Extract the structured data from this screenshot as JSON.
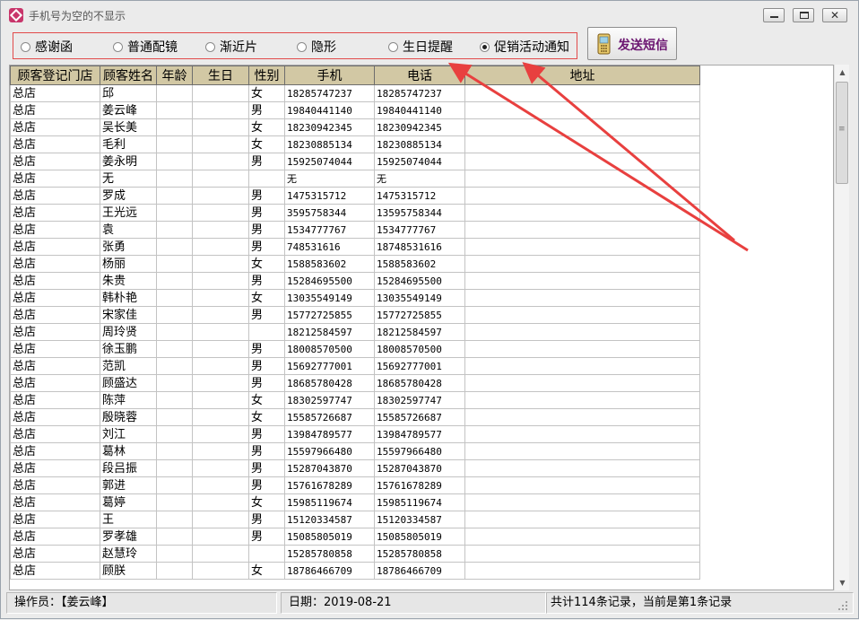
{
  "window": {
    "title": "手机号为空的不显示"
  },
  "message_types": [
    {
      "label": "感谢函",
      "checked": false
    },
    {
      "label": "普通配镜",
      "checked": false
    },
    {
      "label": "渐近片",
      "checked": false
    },
    {
      "label": "隐形",
      "checked": false
    },
    {
      "label": "生日提醒",
      "checked": false
    },
    {
      "label": "促销活动通知",
      "checked": true
    }
  ],
  "send_button": {
    "label": "发送短信",
    "icon": "mobile-phone-icon"
  },
  "table": {
    "columns": [
      "顾客登记门店",
      "顾客姓名",
      "年龄",
      "生日",
      "性别",
      "手机",
      "电话",
      "地址"
    ],
    "rows": [
      [
        "总店",
        "邱",
        "",
        "",
        "女",
        "18285747237",
        "18285747237",
        ""
      ],
      [
        "总店",
        "姜云峰",
        "",
        "",
        "男",
        "19840441140",
        "19840441140",
        ""
      ],
      [
        "总店",
        "吴长美",
        "",
        "",
        "女",
        "18230942345",
        "18230942345",
        ""
      ],
      [
        "总店",
        "毛利",
        "",
        "",
        "女",
        "18230885134",
        "18230885134",
        ""
      ],
      [
        "总店",
        "姜永明",
        "",
        "",
        "男",
        "15925074044",
        "15925074044",
        ""
      ],
      [
        "总店",
        "无",
        "",
        "",
        "",
        "无",
        "无",
        ""
      ],
      [
        "总店",
        "罗成",
        "",
        "",
        "男",
        "1475315712",
        "1475315712",
        ""
      ],
      [
        "总店",
        "王光远",
        "",
        "",
        "男",
        "3595758344",
        "13595758344",
        ""
      ],
      [
        "总店",
        "袁",
        "",
        "",
        "男",
        "1534777767",
        "1534777767",
        ""
      ],
      [
        "总店",
        "张勇",
        "",
        "",
        "男",
        "748531616",
        "18748531616",
        ""
      ],
      [
        "总店",
        "杨丽",
        "",
        "",
        "女",
        "1588583602",
        "1588583602",
        ""
      ],
      [
        "总店",
        "朱贵",
        "",
        "",
        "男",
        "15284695500",
        "15284695500",
        ""
      ],
      [
        "总店",
        "韩朴艳",
        "",
        "",
        "女",
        "13035549149",
        "13035549149",
        ""
      ],
      [
        "总店",
        "宋家佳",
        "",
        "",
        "男",
        "15772725855",
        "15772725855",
        ""
      ],
      [
        "总店",
        "周玲贤",
        "",
        "",
        "",
        "18212584597",
        "18212584597",
        ""
      ],
      [
        "总店",
        "徐玉鹏",
        "",
        "",
        "男",
        "18008570500",
        "18008570500",
        ""
      ],
      [
        "总店",
        "范凯",
        "",
        "",
        "男",
        "15692777001",
        "15692777001",
        ""
      ],
      [
        "总店",
        "顾盛达",
        "",
        "",
        "男",
        "18685780428",
        "18685780428",
        ""
      ],
      [
        "总店",
        "陈萍",
        "",
        "",
        "女",
        "18302597747",
        "18302597747",
        ""
      ],
      [
        "总店",
        "殷晓蓉",
        "",
        "",
        "女",
        "15585726687",
        "15585726687",
        ""
      ],
      [
        "总店",
        "刘江",
        "",
        "",
        "男",
        "13984789577",
        "13984789577",
        ""
      ],
      [
        "总店",
        "葛林",
        "",
        "",
        "男",
        "15597966480",
        "15597966480",
        ""
      ],
      [
        "总店",
        "段吕振",
        "",
        "",
        "男",
        "15287043870",
        "15287043870",
        ""
      ],
      [
        "总店",
        "郭进",
        "",
        "",
        "男",
        "15761678289",
        "15761678289",
        ""
      ],
      [
        "总店",
        "葛婷",
        "",
        "",
        "女",
        "15985119674",
        "15985119674",
        ""
      ],
      [
        "总店",
        "王",
        "",
        "",
        "男",
        "15120334587",
        "15120334587",
        ""
      ],
      [
        "总店",
        "罗孝雄",
        "",
        "",
        "男",
        "15085805019",
        "15085805019",
        ""
      ],
      [
        "总店",
        "赵慧玲",
        "",
        "",
        "",
        "15285780858",
        "15285780858",
        ""
      ],
      [
        "总店",
        "顾朕",
        "",
        "",
        "女",
        "18786466709",
        "18786466709",
        ""
      ]
    ]
  },
  "status": {
    "operator": "操作员：【姜云峰】",
    "date": "日期：2019-08-21",
    "records": "共计114条记录，当前是第1条记录"
  },
  "colors": {
    "header_bg": "#d2c8a4",
    "highlight_border": "#e24a4a",
    "arrow": "#e8403f",
    "send_text": "#6b1570"
  }
}
